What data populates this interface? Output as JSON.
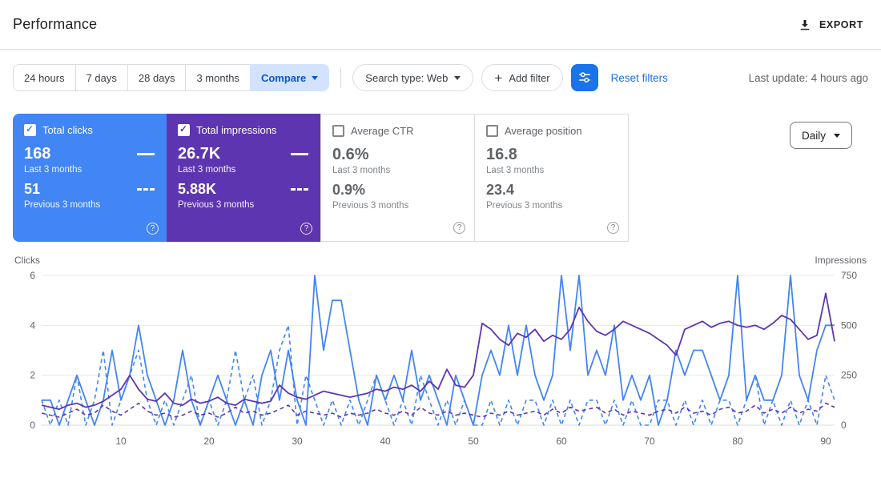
{
  "header": {
    "title": "Performance",
    "export_label": "EXPORT"
  },
  "filter_bar": {
    "date_tabs": [
      {
        "label": "24 hours",
        "selected": false
      },
      {
        "label": "7 days",
        "selected": false
      },
      {
        "label": "28 days",
        "selected": false
      },
      {
        "label": "3 months",
        "selected": false
      },
      {
        "label": "Compare",
        "selected": true
      }
    ],
    "search_type_label": "Search type: Web",
    "add_filter_label": "Add filter",
    "reset_filters_label": "Reset filters",
    "last_update": "Last update: 4 hours ago"
  },
  "cards": [
    {
      "label": "Total clicks",
      "checked": true,
      "color": "#4285f4",
      "primary_value": "168",
      "primary_caption": "Last 3 months",
      "secondary_value": "51",
      "secondary_caption": "Previous 3 months"
    },
    {
      "label": "Total impressions",
      "checked": true,
      "color": "#5e35b1",
      "primary_value": "26.7K",
      "primary_caption": "Last 3 months",
      "secondary_value": "5.88K",
      "secondary_caption": "Previous 3 months"
    },
    {
      "label": "Average CTR",
      "checked": false,
      "primary_value": "0.6%",
      "primary_caption": "Last 3 months",
      "secondary_value": "0.9%",
      "secondary_caption": "Previous 3 months"
    },
    {
      "label": "Average position",
      "checked": false,
      "primary_value": "16.8",
      "primary_caption": "Last 3 months",
      "secondary_value": "23.4",
      "secondary_caption": "Previous 3 months"
    }
  ],
  "granularity_label": "Daily",
  "chart_data": {
    "type": "line",
    "days": 91,
    "x_ticks": [
      10,
      20,
      30,
      40,
      50,
      60,
      70,
      80,
      90
    ],
    "left_axis": {
      "label": "Clicks",
      "ticks": [
        0,
        2,
        4,
        6
      ],
      "max": 6
    },
    "right_axis": {
      "label": "Impressions",
      "ticks": [
        0,
        250,
        500,
        750
      ],
      "max": 750
    },
    "series": [
      {
        "name": "Clicks - Last 3 months",
        "axis": "left",
        "style": "solid",
        "color": "#4285f4",
        "values": [
          1,
          1,
          0,
          1,
          2,
          1,
          0,
          1,
          3,
          1,
          2,
          4,
          2,
          1,
          0,
          1,
          3,
          1,
          0,
          1,
          2,
          1,
          0,
          1,
          0,
          2,
          3,
          1,
          3,
          1,
          0,
          6,
          3,
          5,
          5,
          3,
          1,
          0,
          2,
          1,
          2,
          1,
          3,
          1,
          2,
          1,
          0,
          2,
          1,
          0,
          2,
          3,
          2,
          4,
          2,
          4,
          2,
          1,
          2,
          6,
          3,
          6,
          2,
          3,
          2,
          4,
          1,
          2,
          1,
          2,
          0,
          1,
          3,
          2,
          3,
          3,
          2,
          1,
          2,
          6,
          1,
          2,
          1,
          1,
          2,
          6,
          2,
          1,
          3,
          4,
          4
        ]
      },
      {
        "name": "Clicks - Previous 3 months",
        "axis": "left",
        "style": "dashed",
        "color": "#4285f4",
        "values": [
          1,
          0,
          1,
          0,
          2,
          0,
          1,
          3,
          0,
          1,
          2,
          3,
          1,
          0,
          1,
          0,
          1,
          2,
          0,
          1,
          0,
          1,
          3,
          1,
          2,
          0,
          1,
          3,
          4,
          0,
          2,
          1,
          0,
          1,
          0,
          1,
          0,
          1,
          2,
          1,
          0,
          1,
          0,
          2,
          1,
          0,
          1,
          0,
          1,
          0,
          0,
          1,
          0,
          1,
          0,
          1,
          1,
          0,
          1,
          0,
          1,
          0,
          1,
          1,
          0,
          1,
          0,
          1,
          0,
          0,
          1,
          1,
          0,
          1,
          0,
          1,
          0,
          1,
          1,
          0,
          1,
          2,
          0,
          1,
          0,
          1,
          0,
          1,
          0,
          2,
          1
        ]
      },
      {
        "name": "Impressions - Last 3 months",
        "axis": "right",
        "style": "solid",
        "color": "#5e35b1",
        "values": [
          100,
          90,
          80,
          100,
          110,
          90,
          100,
          120,
          150,
          180,
          250,
          180,
          130,
          120,
          160,
          110,
          100,
          130,
          110,
          120,
          140,
          110,
          100,
          130,
          120,
          110,
          120,
          200,
          160,
          140,
          130,
          150,
          170,
          160,
          150,
          140,
          150,
          160,
          180,
          170,
          190,
          180,
          200,
          170,
          220,
          180,
          280,
          200,
          190,
          250,
          510,
          480,
          430,
          400,
          460,
          440,
          480,
          420,
          450,
          430,
          480,
          590,
          520,
          470,
          450,
          480,
          520,
          500,
          480,
          460,
          430,
          400,
          350,
          480,
          500,
          520,
          490,
          510,
          520,
          500,
          490,
          500,
          480,
          510,
          550,
          530,
          480,
          430,
          450,
          660,
          420
        ]
      },
      {
        "name": "Impressions - Previous 3 months",
        "axis": "right",
        "style": "dashed",
        "color": "#5e35b1",
        "values": [
          60,
          50,
          40,
          60,
          80,
          50,
          60,
          100,
          70,
          50,
          80,
          110,
          70,
          50,
          60,
          40,
          50,
          70,
          50,
          60,
          40,
          60,
          90,
          60,
          70,
          50,
          60,
          80,
          100,
          50,
          70,
          60,
          50,
          60,
          40,
          60,
          50,
          60,
          80,
          60,
          50,
          70,
          50,
          90,
          60,
          50,
          70,
          50,
          60,
          50,
          40,
          60,
          50,
          70,
          50,
          60,
          70,
          50,
          80,
          60,
          90,
          70,
          80,
          90,
          60,
          80,
          50,
          70,
          60,
          50,
          70,
          80,
          60,
          90,
          60,
          70,
          50,
          80,
          90,
          60,
          70,
          100,
          60,
          80,
          60,
          90,
          60,
          80,
          70,
          110,
          90
        ]
      }
    ]
  }
}
